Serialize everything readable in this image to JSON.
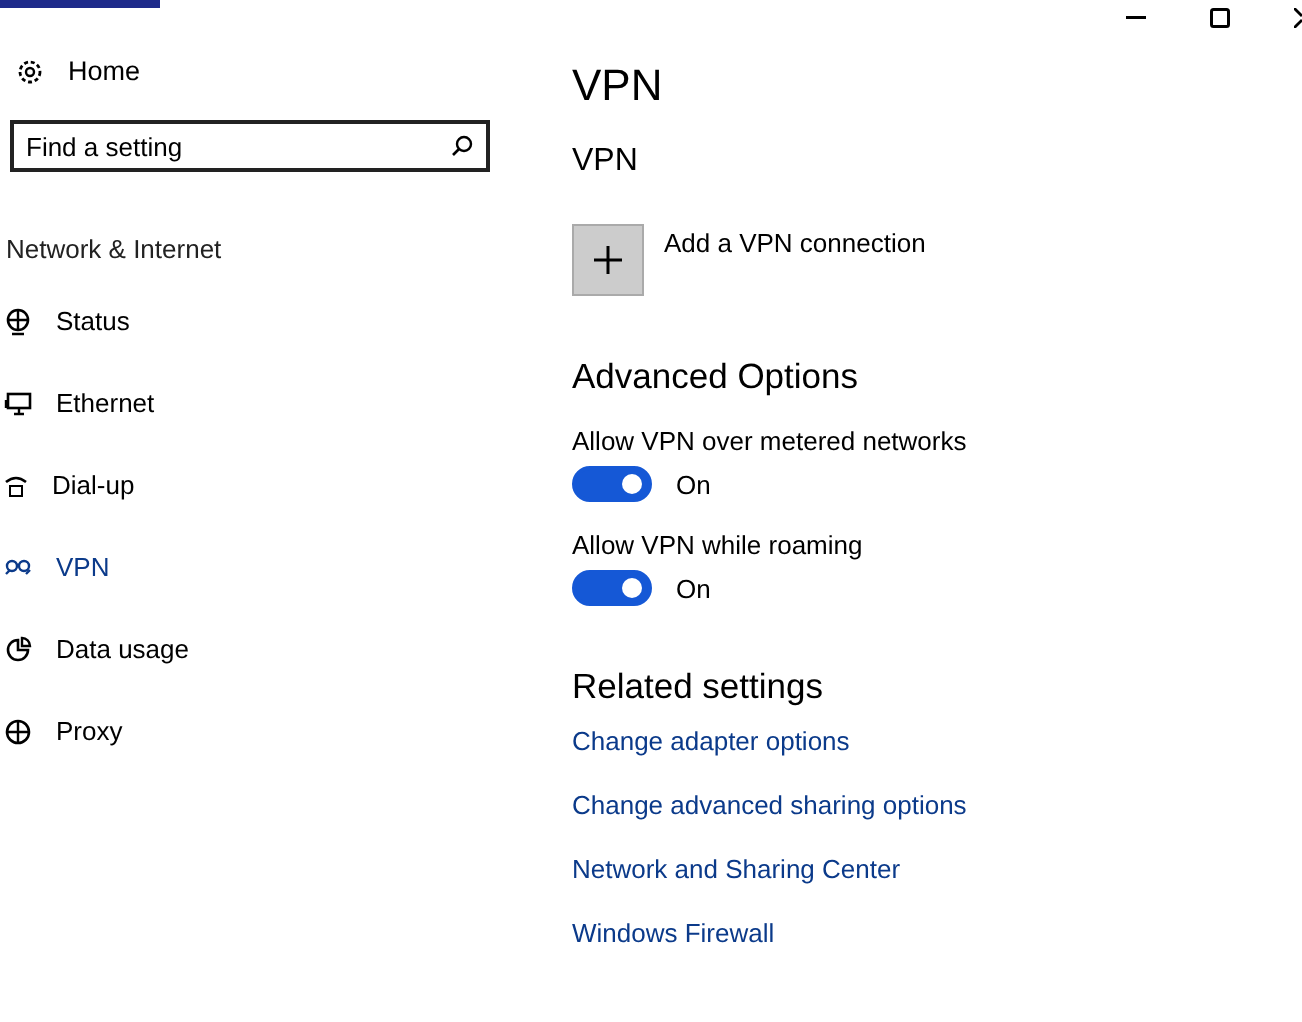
{
  "window": {
    "controls": [
      {
        "kind": "minimize"
      },
      {
        "kind": "maximize"
      },
      {
        "kind": "close"
      }
    ]
  },
  "sidebar": {
    "home": "Home",
    "search": {
      "placeholder": "Find a setting"
    },
    "section": "Network & Internet",
    "items": [
      {
        "kind": "status",
        "label": "Status",
        "selected": false
      },
      {
        "kind": "ethernet",
        "label": "Ethernet",
        "selected": false
      },
      {
        "kind": "dialup",
        "label": "Dial-up",
        "selected": false
      },
      {
        "kind": "vpn",
        "label": "VPN",
        "selected": true
      },
      {
        "kind": "data",
        "label": "Data usage",
        "selected": false
      },
      {
        "kind": "proxy",
        "label": "Proxy",
        "selected": false
      }
    ]
  },
  "content": {
    "title": "VPN",
    "section": "VPN",
    "add_button": "Add a VPN connection",
    "advanced_heading": "Advanced Options",
    "toggles": [
      {
        "label": "Allow VPN over metered networks",
        "on": true,
        "state_text": "On"
      },
      {
        "label": "Allow VPN while roaming",
        "on": true,
        "state_text": "On"
      }
    ],
    "related_heading": "Related settings",
    "links": [
      "Change adapter options",
      "Change advanced sharing options",
      "Network and Sharing Center",
      "Windows Firewall"
    ]
  }
}
